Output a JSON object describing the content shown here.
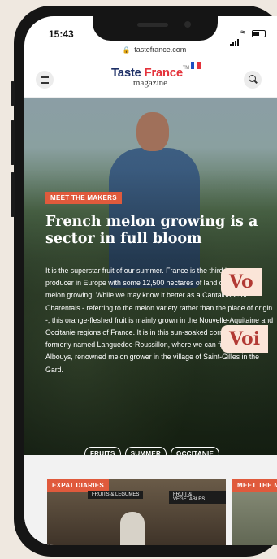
{
  "status": {
    "time": "15:43"
  },
  "browser": {
    "url": "tastefrance.com"
  },
  "logo": {
    "word1": "Taste",
    "word2": "France",
    "tm": "TM",
    "subtitle": "magazine"
  },
  "colors": {
    "accent": "#e05a3c",
    "brand_blue": "#1d2f66",
    "brand_red": "#e4323b",
    "flag_blue": "#1f4fc1",
    "flag_red": "#e4323b"
  },
  "icons": {
    "menu": "hamburger-icon",
    "search": "search-icon",
    "lock": "lock-icon"
  },
  "hero": {
    "tag": "MEET THE MAKERS",
    "title": "French melon growing is a sector in full bloom",
    "body": "It is the superstar fruit of our summer. France is the third largest producer in Europe with some 12,500 hectares of land dedicated to melon growing. While we may know it better as a Cantaloupe or Charentais - referring to the melon variety rather than the place of origin -, this orange-fleshed fruit is mainly grown in the Nouvelle-Aquitaine and Occitanie regions of France. It is in this sun-soaked corner of France, formerly named Languedoc-Roussillon, where we can find Patrick Albouys, renowned melon grower in the village of Saint-Gilles in the Gard.",
    "chips": [
      "FRUITS",
      "SUMMER",
      "OCCITANIE"
    ]
  },
  "overlays": [
    "Vo",
    "Voi"
  ],
  "cards": [
    {
      "tag": "EXPAT DIARIES",
      "sign1": "FRUITS & LEGUMES",
      "sign2": "FRUIT & VEGETABLES"
    },
    {
      "tag": "MEET THE M"
    }
  ]
}
